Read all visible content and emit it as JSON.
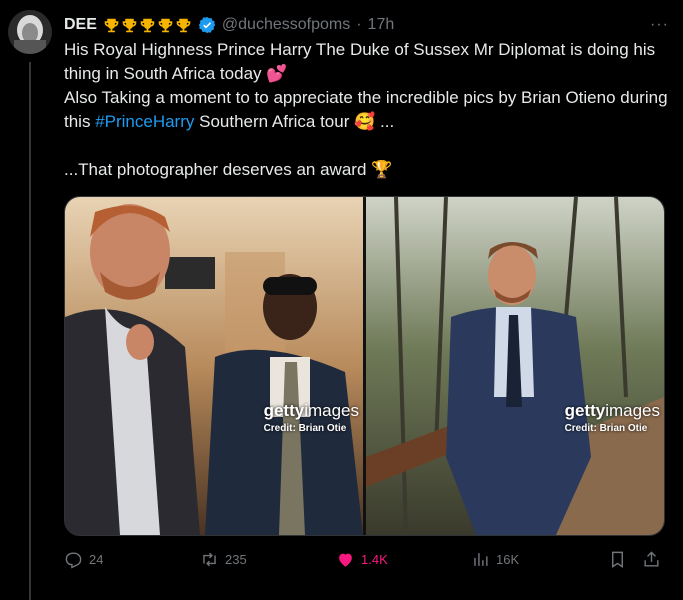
{
  "tweet": {
    "author_name": "DEE",
    "trophy_icons": [
      "trophy-icon",
      "trophy-icon",
      "trophy-icon",
      "trophy-icon",
      "trophy-icon"
    ],
    "handle": "@duchessofpoms",
    "separator": "·",
    "time": "17h",
    "more_label": "···",
    "line1": "His Royal Highness Prince Harry The Duke of Sussex Mr Diplomat is doing his thing in South Africa today",
    "line1_emoji": "💕",
    "line2_before": "Also Taking a moment to to appreciate the incredible pics by Brian Otieno during this ",
    "hashtag": "#PrinceHarry",
    "line2_after": " Southern Africa tour",
    "line2_emoji": "🥰",
    "line2_tail": " ...",
    "line3": "...That photographer deserves an award",
    "line3_emoji": "🏆"
  },
  "media": {
    "photos": [
      {
        "brand": "getty",
        "brand_suffix": "images",
        "credit": "Credit: Brian Otie"
      },
      {
        "brand": "getty",
        "brand_suffix": "images",
        "credit": "Credit: Brian Otie"
      }
    ]
  },
  "actions": {
    "reply_count": "24",
    "repost_count": "235",
    "like_count": "1.4K",
    "views_count": "16K"
  },
  "colors": {
    "background": "#000000",
    "text": "#e7e9ea",
    "muted": "#71767b",
    "link": "#1d9bf0",
    "like": "#f91880",
    "verified": "#1d9bf0",
    "trophy": "#f5b400"
  }
}
